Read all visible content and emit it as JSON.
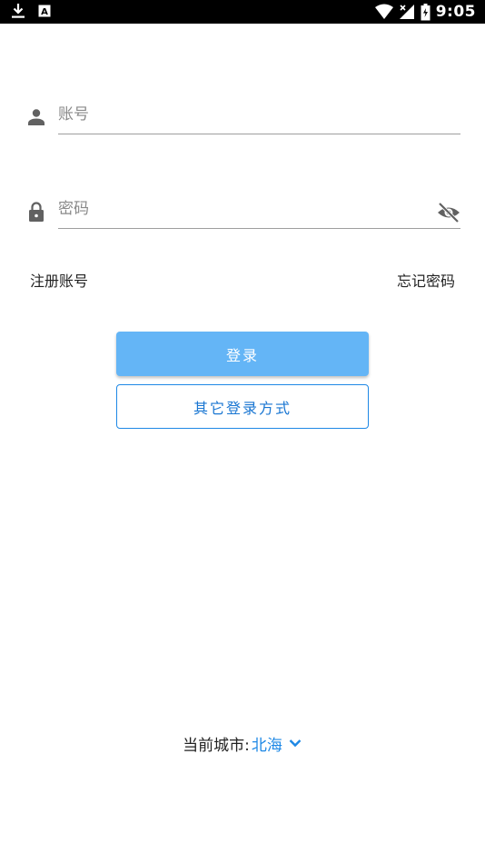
{
  "status_bar": {
    "time": "9:05",
    "left_icons": [
      "download-icon",
      "font-app-icon"
    ],
    "right_icons": [
      "wifi-icon",
      "signal-icon",
      "battery-icon"
    ],
    "font_app_glyph": "A"
  },
  "login": {
    "account_placeholder": "账号",
    "password_placeholder": "密码",
    "register_link": "注册账号",
    "forgot_link": "忘记密码",
    "login_button": "登录",
    "other_login_button": "其它登录方式"
  },
  "city": {
    "label": "当前城市:",
    "value": "北海"
  },
  "colors": {
    "primary": "#64b5f6",
    "accent": "#1e88e5",
    "icon_gray": "#616161",
    "status_bar": "#000000"
  }
}
